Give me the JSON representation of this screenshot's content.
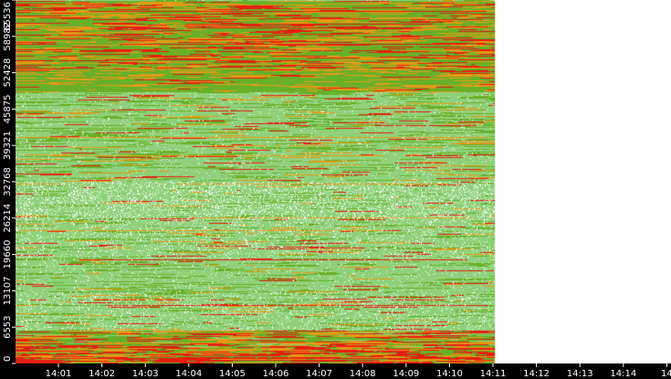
{
  "chart_data": {
    "type": "heatmap",
    "title": "",
    "xlabel": "",
    "ylabel": "",
    "x_ticks": [
      "14:01",
      "14:02",
      "14:03",
      "14:04",
      "14:05",
      "14:06",
      "14:07",
      "14:08",
      "14:09",
      "14:10",
      "14:11",
      "14:12",
      "14:13",
      "14:14",
      "14"
    ],
    "y_ticks": [
      "0",
      "6553",
      "13107",
      "19660",
      "26214",
      "32768",
      "39321",
      "45875",
      "52428",
      "58982",
      "65536"
    ],
    "ylim": [
      0,
      65536
    ],
    "data_x_range": [
      "14:00",
      "14:11"
    ],
    "bands": [
      {
        "from": 0,
        "to": 3000,
        "level": "high"
      },
      {
        "from": 3000,
        "to": 6000,
        "level": "mixed-high"
      },
      {
        "from": 6000,
        "to": 13000,
        "level": "low-sparse"
      },
      {
        "from": 13000,
        "to": 19000,
        "level": "low"
      },
      {
        "from": 19000,
        "to": 26000,
        "level": "low-sparse"
      },
      {
        "from": 26000,
        "to": 32800,
        "level": "low-very-sparse"
      },
      {
        "from": 32800,
        "to": 49000,
        "level": "low-mixed"
      },
      {
        "from": 49000,
        "to": 53000,
        "level": "mixed"
      },
      {
        "from": 53000,
        "to": 65536,
        "level": "high-mixed"
      }
    ],
    "color_scale": {
      "empty": "#ffffff",
      "low": "#8fd17a",
      "medium": "#67b028",
      "elevated": "#e39a18",
      "high": "#e61e10"
    },
    "axis_background": "#000000",
    "axis_text_color": "#ffffff"
  }
}
